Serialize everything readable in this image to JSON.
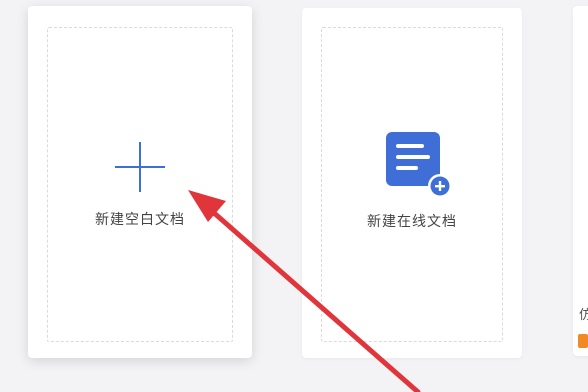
{
  "cards": {
    "blank": {
      "label": "新建空白文档"
    },
    "online": {
      "label": "新建在线文档"
    },
    "partial": {
      "label_fragment": "仿"
    }
  },
  "colors": {
    "accent_blue": "#3f6fd6",
    "arrow_red": "#e0353a",
    "badge_orange": "#f08a24"
  },
  "icons": [
    "plus-icon",
    "online-doc-add-icon",
    "annotation-arrow"
  ]
}
